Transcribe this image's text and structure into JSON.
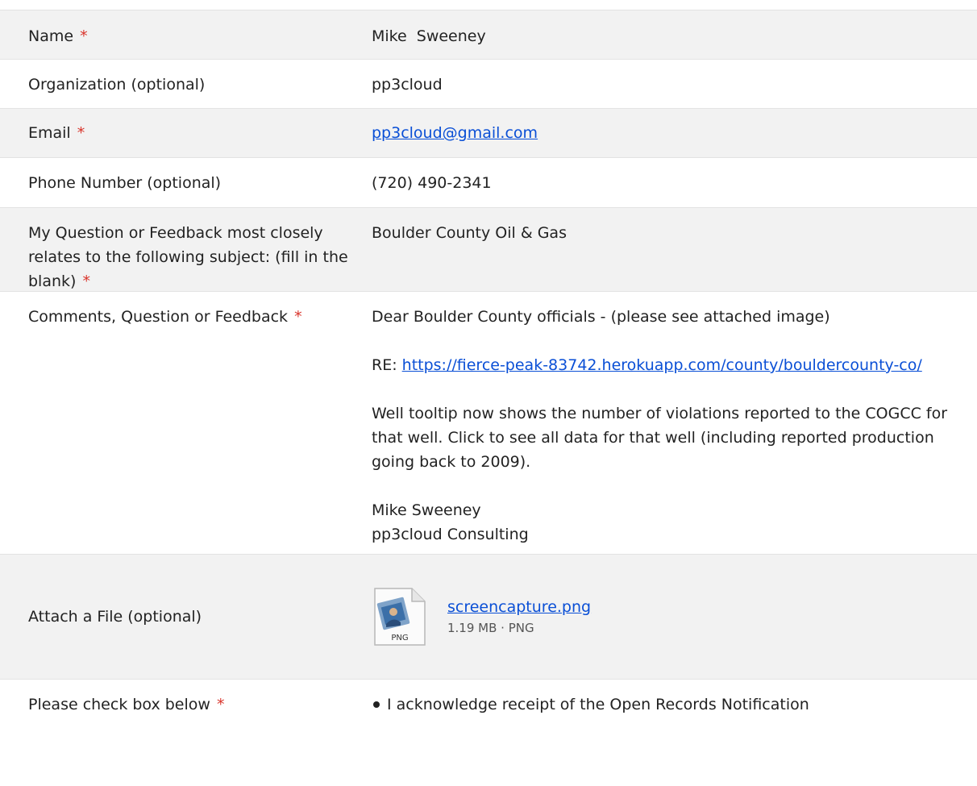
{
  "fields": {
    "name": {
      "label": "Name",
      "required": "*",
      "value": "Mike  Sweeney"
    },
    "organization": {
      "label": "Organization (optional)",
      "value": "pp3cloud"
    },
    "email": {
      "label": "Email",
      "required": "*",
      "value": "pp3cloud@gmail.com"
    },
    "phone": {
      "label": "Phone Number (optional)",
      "value": "(720) 490-2341"
    },
    "subject": {
      "label": "My Question or Feedback most closely relates to the following subject: (fill in the blank)",
      "required": "*",
      "value": "Boulder County Oil & Gas"
    },
    "comments": {
      "label": "Comments, Question or Feedback",
      "required": "*",
      "line1": "Dear Boulder County officials - (please see attached image)",
      "re_prefix": "RE:",
      "re_link": "https://fierce-peak-83742.herokuapp.com/county/bouldercounty-co/",
      "paragraph": "Well tooltip now shows the number of violations reported to the COGCC for that well. Click to see all data for that well (including reported production going back to 2009).",
      "signature_name": "Mike Sweeney",
      "signature_company": "pp3cloud Consulting"
    },
    "attachment": {
      "label": "Attach a File (optional)",
      "file_name": "screencapture.png",
      "file_meta": "1.19 MB · PNG",
      "icon_text": "PNG"
    },
    "acknowledge": {
      "label": "Please check box below",
      "required": "*",
      "item": "I acknowledge receipt of the Open Records Notification"
    }
  },
  "colors": {
    "required": "#d9342b",
    "link": "#0a4fd6",
    "shaded_row": "#f2f2f2"
  }
}
